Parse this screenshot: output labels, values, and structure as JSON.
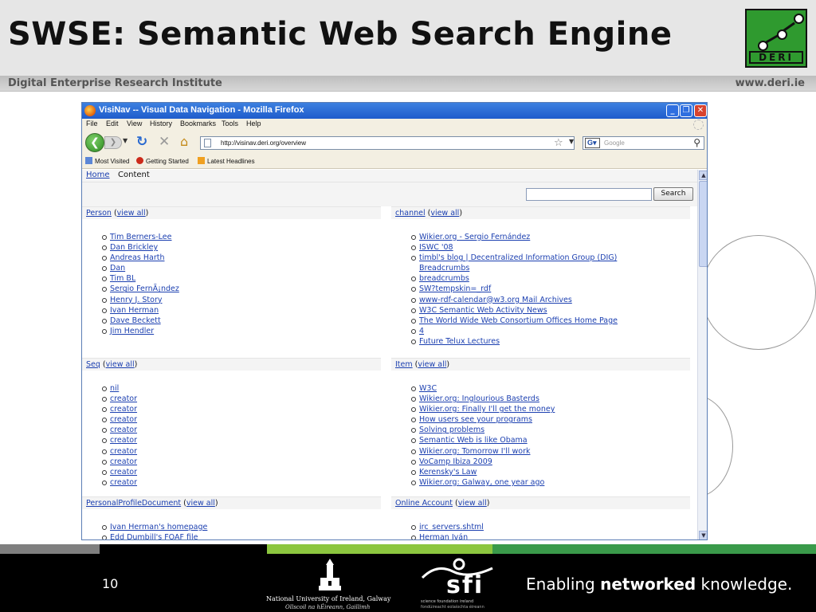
{
  "slide": {
    "title": "SWSE: Semantic Web Search Engine",
    "institute": "Digital Enterprise Research Institute",
    "site_url": "www.deri.ie",
    "logo_word": "DERI",
    "page_number": "10",
    "university_name": "National University of Ireland, Galway",
    "university_irish": "Ollscoil na hÉireann, Gaillimh",
    "sfi_text": "sfi",
    "sfi_sub": "science foundation ireland",
    "sfi_sub_irish": "fondúireacht eolaíochta éireann",
    "tagline_prefix": "Enabling ",
    "tagline_bold": "networked",
    "tagline_suffix": " knowledge.",
    "strip_colors": [
      "#7f7f7f",
      "#000000",
      "#8cc63f",
      "#3a9a4a"
    ]
  },
  "browser": {
    "window_title": "VisiNav -- Visual Data Navigation - Mozilla Firefox",
    "menu": [
      "File",
      "Edit",
      "View",
      "History",
      "Bookmarks",
      "Tools",
      "Help"
    ],
    "url": "http://visinav.deri.org/overview",
    "search_placeholder": "Google",
    "bookmarks": [
      "Most Visited",
      "Getting Started",
      "Latest Headlines"
    ]
  },
  "page": {
    "nav_home": "Home",
    "nav_current": "Content",
    "search_button": "Search",
    "view_all": "view all",
    "sections": {
      "person": {
        "title": "Person",
        "items": [
          "Tim Berners-Lee",
          "Dan Brickley",
          "Andreas Harth",
          "Dan",
          "Tim BL",
          "Sergio FernÃ¡ndez",
          "Henry J. Story",
          "Ivan Herman",
          "Dave Beckett",
          "Jim Hendler"
        ]
      },
      "channel": {
        "title": "channel",
        "items": [
          "Wikier.org - Sergio Fernández",
          "ISWC '08",
          "timbl's blog | Decentralized Information Group (DIG)",
          "Breadcrumbs",
          "breadcrumbs",
          "SW?tempskin=_rdf",
          "www-rdf-calendar@w3.org Mail Archives",
          "W3C Semantic Web Activity News",
          "The World Wide Web Consortium Offices Home Page",
          "4",
          "Future Telux Lectures"
        ]
      },
      "seq": {
        "title": "Seq",
        "items": [
          "nil",
          "creator",
          "creator",
          "creator",
          "creator",
          "creator",
          "creator",
          "creator",
          "creator",
          "creator"
        ]
      },
      "item": {
        "title": "Item",
        "items": [
          "W3C",
          "Wikier.org: Inglourious Basterds",
          "Wikier.org: Finally I'll get the money",
          "How users see your programs",
          "Solving problems",
          "Semantic Web is like Obama",
          "Wikier.org: Tomorrow I'll work",
          "VoCamp Ibiza 2009",
          "Kerensky's Law",
          "Wikier.org: Galway, one year ago"
        ]
      },
      "ppd": {
        "title": "PersonalProfileDocument",
        "items": [
          "Ivan Herman's homepage",
          "Edd Dumbill's FOAF file"
        ]
      },
      "account": {
        "title": "Online Account",
        "items": [
          "irc_servers.shtml",
          "Herman Iván"
        ]
      }
    }
  }
}
